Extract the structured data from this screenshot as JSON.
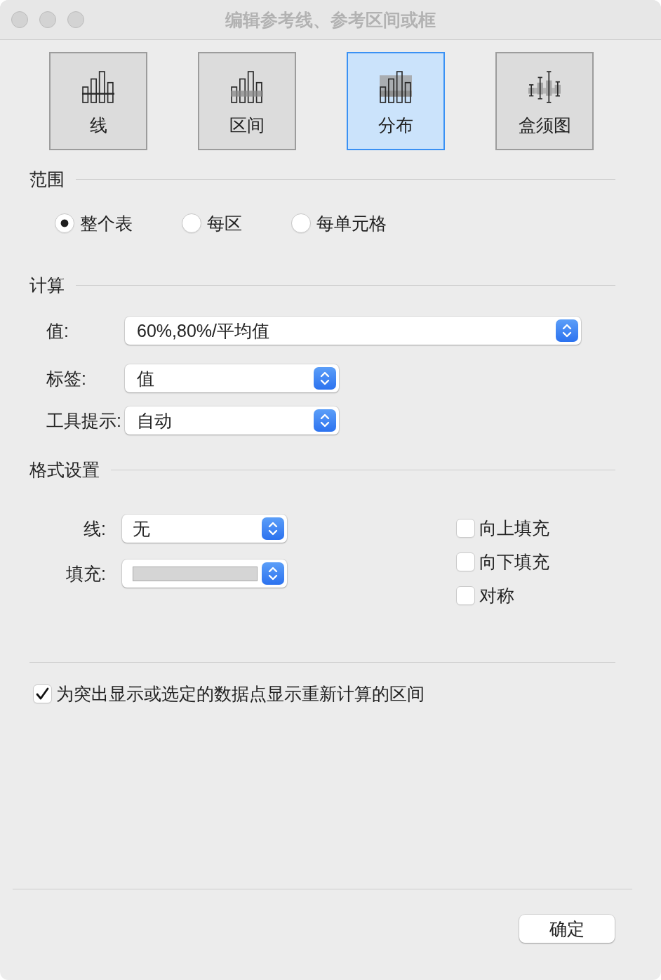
{
  "window": {
    "title": "编辑参考线、参考区间或框"
  },
  "types": [
    {
      "kind": "line",
      "label": "线",
      "selected": false
    },
    {
      "kind": "band",
      "label": "区间",
      "selected": false
    },
    {
      "kind": "distribution",
      "label": "分布",
      "selected": true
    },
    {
      "kind": "boxplot",
      "label": "盒须图",
      "selected": false
    }
  ],
  "scope": {
    "title": "范围",
    "options": [
      {
        "label": "整个表",
        "selected": true
      },
      {
        "label": "每区",
        "selected": false
      },
      {
        "label": "每单元格",
        "selected": false
      }
    ]
  },
  "computation": {
    "title": "计算",
    "fields": [
      {
        "label": "值:",
        "value": "60%,80%/平均值"
      },
      {
        "label": "标签:",
        "value": "值"
      },
      {
        "label": "工具提示:",
        "value": "自动"
      }
    ]
  },
  "formatting": {
    "title": "格式设置",
    "line": {
      "label": "线:",
      "value": "无"
    },
    "fill": {
      "label": "填充:",
      "color": "#d5d5d5"
    },
    "options": [
      {
        "label": "向上填充",
        "checked": false
      },
      {
        "label": "向下填充",
        "checked": false
      },
      {
        "label": "对称",
        "checked": false
      }
    ]
  },
  "recalc": {
    "label": "为突出显示或选定的数据点显示重新计算的区间",
    "checked": true
  },
  "buttons": [
    "确定"
  ]
}
